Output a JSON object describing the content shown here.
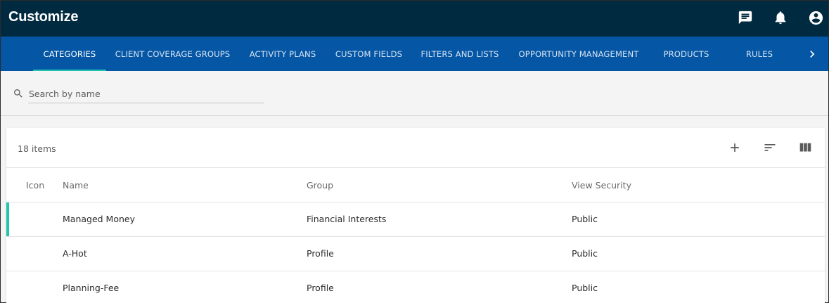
{
  "app": {
    "title": "Customize"
  },
  "appbar_icons": [
    "chat-icon",
    "bell-icon",
    "account-icon"
  ],
  "tabs": [
    {
      "label": "CATEGORIES",
      "active": true
    },
    {
      "label": "CLIENT COVERAGE GROUPS"
    },
    {
      "label": "ACTIVITY PLANS"
    },
    {
      "label": "CUSTOM FIELDS"
    },
    {
      "label": "FILTERS AND LISTS"
    },
    {
      "label": "OPPORTUNITY MANAGEMENT"
    },
    {
      "label": "PRODUCTS"
    },
    {
      "label": "RULES"
    }
  ],
  "search": {
    "placeholder": "Search by name",
    "value": ""
  },
  "list": {
    "count_label": "18 items",
    "columns": [
      "Icon",
      "Name",
      "Group",
      "View Security"
    ],
    "rows": [
      {
        "icon": "",
        "name": "Managed Money",
        "group": "Financial Interests",
        "security": "Public"
      },
      {
        "icon": "",
        "name": "A-Hot",
        "group": "Profile",
        "security": "Public"
      },
      {
        "icon": "",
        "name": "Planning-Fee",
        "group": "Profile",
        "security": "Public"
      }
    ]
  },
  "colors": {
    "appbar": "#002a3f",
    "tabbar": "#0556a5",
    "accent": "#20c5b0"
  }
}
